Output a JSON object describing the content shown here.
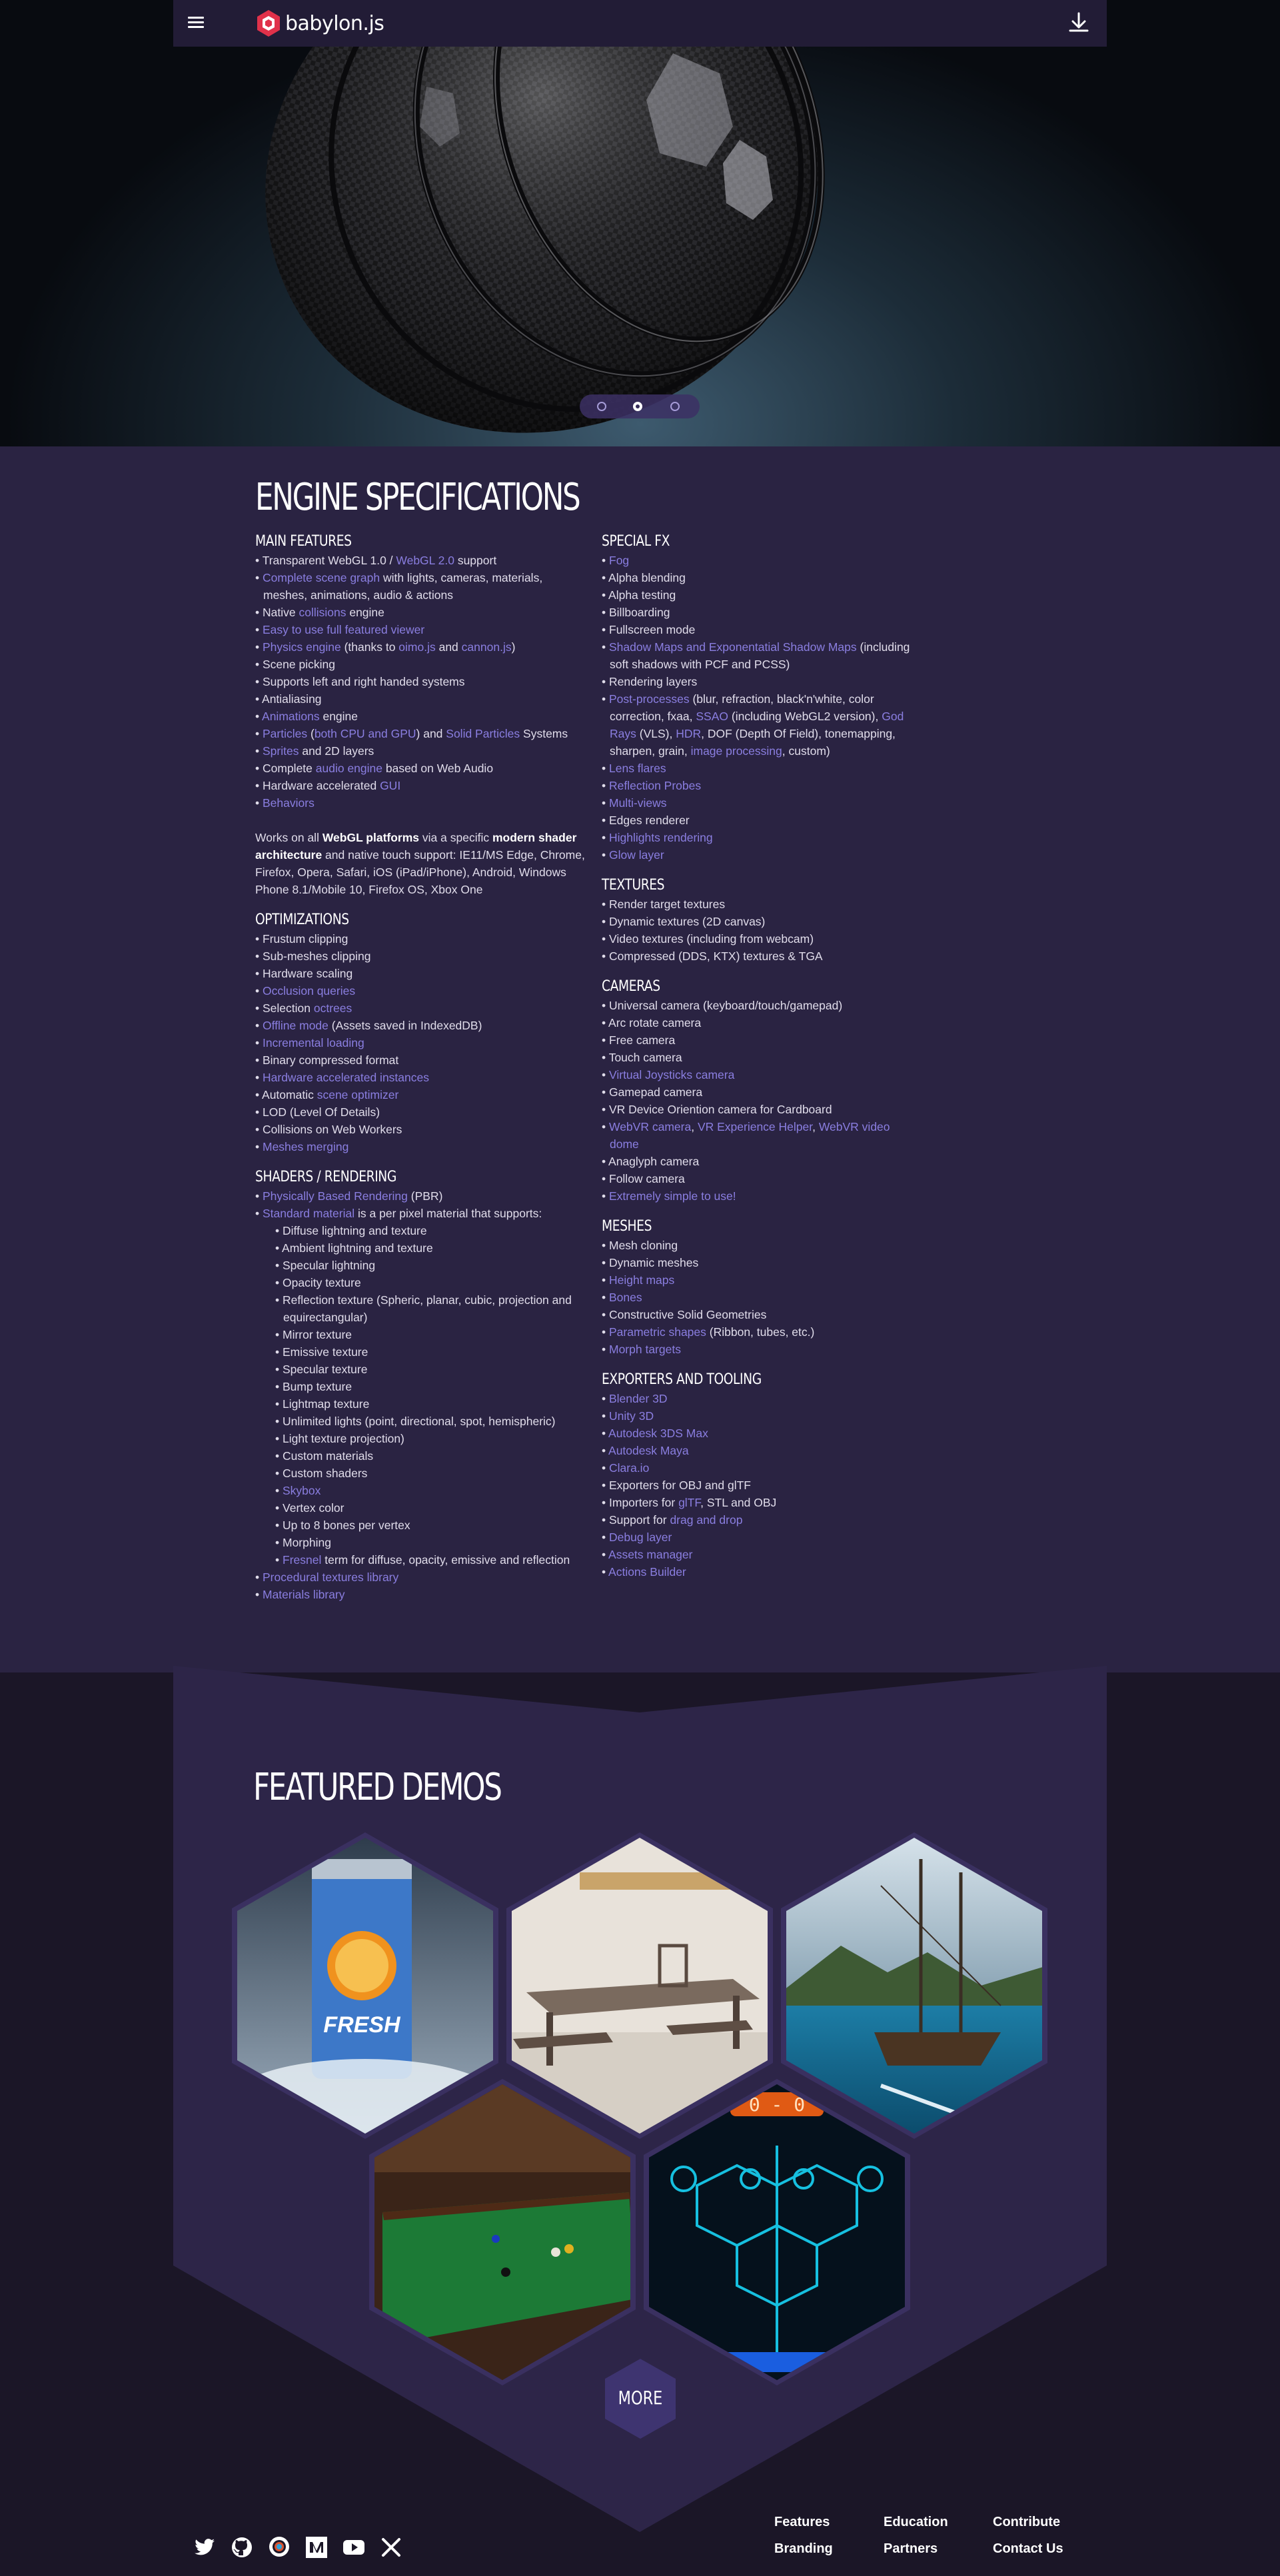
{
  "header": {
    "logo_text": "babylon.js",
    "menu_icon": "hamburger-menu-icon",
    "download_icon": "download-icon"
  },
  "hero": {
    "carousel_dots": 3,
    "active_dot": 2
  },
  "specs": {
    "title": "ENGINE SPECIFICATIONS",
    "main_features": {
      "heading": "MAIN FEATURES",
      "items": [
        [
          {
            "t": "Transparent WebGL 1.0 / "
          },
          {
            "t": "WebGL 2.0",
            "l": true
          },
          {
            "t": " support"
          }
        ],
        [
          {
            "t": "Complete scene graph",
            "l": true
          },
          {
            "t": " with lights, cameras, materials, meshes, animations, audio & actions"
          }
        ],
        [
          {
            "t": "Native "
          },
          {
            "t": "collisions",
            "l": true
          },
          {
            "t": " engine"
          }
        ],
        [
          {
            "t": "Easy to use full featured viewer",
            "l": true
          }
        ],
        [
          {
            "t": "Physics engine",
            "l": true
          },
          {
            "t": " (thanks to "
          },
          {
            "t": "oimo.js",
            "l": true
          },
          {
            "t": " and "
          },
          {
            "t": "cannon.js",
            "l": true
          },
          {
            "t": ")"
          }
        ],
        [
          {
            "t": "Scene picking"
          }
        ],
        [
          {
            "t": "Supports left and right handed systems"
          }
        ],
        [
          {
            "t": "Antialiasing"
          }
        ],
        [
          {
            "t": "Animations",
            "l": true
          },
          {
            "t": " engine"
          }
        ],
        [
          {
            "t": "Particles",
            "l": true
          },
          {
            "t": " ("
          },
          {
            "t": "both CPU and GPU",
            "l": true
          },
          {
            "t": ") and "
          },
          {
            "t": "Solid Particles",
            "l": true
          },
          {
            "t": " Systems"
          }
        ],
        [
          {
            "t": "Sprites",
            "l": true
          },
          {
            "t": " and 2D layers"
          }
        ],
        [
          {
            "t": "Complete "
          },
          {
            "t": "audio engine",
            "l": true
          },
          {
            "t": " based on Web Audio"
          }
        ],
        [
          {
            "t": "Hardware accelerated "
          },
          {
            "t": "GUI",
            "l": true
          }
        ],
        [
          {
            "t": "Behaviors",
            "l": true
          }
        ]
      ],
      "platform_text_1": "Works on all ",
      "platform_bold_1": "WebGL platforms",
      "platform_text_2": " via a specific ",
      "platform_bold_2": "modern shader architecture",
      "platform_text_3": " and native touch support: IE11/MS Edge, Chrome, Firefox, Opera, Safari, iOS (iPad/iPhone), Android, Windows Phone 8.1/Mobile 10, Firefox OS, Xbox One"
    },
    "optimizations": {
      "heading": "OPTIMIZATIONS",
      "items": [
        [
          {
            "t": "Frustum clipping"
          }
        ],
        [
          {
            "t": "Sub-meshes clipping"
          }
        ],
        [
          {
            "t": "Hardware scaling"
          }
        ],
        [
          {
            "t": "Occlusion queries",
            "l": true
          }
        ],
        [
          {
            "t": "Selection "
          },
          {
            "t": "octrees",
            "l": true
          }
        ],
        [
          {
            "t": "Offline mode",
            "l": true
          },
          {
            "t": " (Assets saved in IndexedDB)"
          }
        ],
        [
          {
            "t": "Incremental loading",
            "l": true
          }
        ],
        [
          {
            "t": "Binary compressed format"
          }
        ],
        [
          {
            "t": "Hardware accelerated instances",
            "l": true
          }
        ],
        [
          {
            "t": "Automatic "
          },
          {
            "t": "scene optimizer",
            "l": true
          }
        ],
        [
          {
            "t": "LOD (Level Of Details)"
          }
        ],
        [
          {
            "t": "Collisions on Web Workers"
          }
        ],
        [
          {
            "t": "Meshes merging",
            "l": true
          }
        ]
      ]
    },
    "shaders": {
      "heading": "SHADERS / RENDERING",
      "items": [
        [
          {
            "t": "Physically Based Rendering",
            "l": true
          },
          {
            "t": " (PBR)"
          }
        ],
        [
          {
            "t": "Standard material",
            "l": true
          },
          {
            "t": " is a per pixel material that supports:"
          }
        ]
      ],
      "sub_items": [
        [
          {
            "t": "Diffuse lightning and texture"
          }
        ],
        [
          {
            "t": "Ambient lightning and texture"
          }
        ],
        [
          {
            "t": "Specular lightning"
          }
        ],
        [
          {
            "t": "Opacity texture"
          }
        ],
        [
          {
            "t": "Reflection texture (Spheric, planar, cubic, projection and equirectangular)"
          }
        ],
        [
          {
            "t": "Mirror texture"
          }
        ],
        [
          {
            "t": "Emissive texture"
          }
        ],
        [
          {
            "t": "Specular texture"
          }
        ],
        [
          {
            "t": "Bump texture"
          }
        ],
        [
          {
            "t": "Lightmap texture"
          }
        ],
        [
          {
            "t": "Unlimited lights (point, directional, spot, hemispheric)"
          }
        ],
        [
          {
            "t": "Light texture projection)"
          }
        ],
        [
          {
            "t": "Custom materials"
          }
        ],
        [
          {
            "t": "Custom shaders"
          }
        ],
        [
          {
            "t": "Skybox",
            "l": true
          }
        ],
        [
          {
            "t": "Vertex color"
          }
        ],
        [
          {
            "t": "Up to 8 bones per vertex"
          }
        ],
        [
          {
            "t": "Morphing"
          }
        ],
        [
          {
            "t": "Fresnel",
            "l": true
          },
          {
            "t": " term for diffuse, opacity, emissive and reflection"
          }
        ]
      ],
      "tail_items": [
        [
          {
            "t": "Procedural textures library",
            "l": true
          }
        ],
        [
          {
            "t": "Materials library",
            "l": true
          }
        ]
      ]
    },
    "special_fx": {
      "heading": "SPECIAL FX",
      "items": [
        [
          {
            "t": "Fog",
            "l": true
          }
        ],
        [
          {
            "t": "Alpha blending"
          }
        ],
        [
          {
            "t": "Alpha testing"
          }
        ],
        [
          {
            "t": "Billboarding"
          }
        ],
        [
          {
            "t": "Fullscreen mode"
          }
        ],
        [
          {
            "t": "Shadow Maps and Exponentatial Shadow Maps",
            "l": true
          },
          {
            "t": " (including soft shadows with PCF and PCSS)"
          }
        ],
        [
          {
            "t": "Rendering layers"
          }
        ],
        [
          {
            "t": "Post-processes",
            "l": true
          },
          {
            "t": " (blur, refraction, black'n'white, color correction, fxaa, "
          },
          {
            "t": "SSAO",
            "l": true
          },
          {
            "t": " (including WebGL2 version), "
          },
          {
            "t": "God Rays",
            "l": true
          },
          {
            "t": " (VLS), "
          },
          {
            "t": "HDR",
            "l": true
          },
          {
            "t": ", DOF (Depth Of Field), tonemapping, sharpen, grain, "
          },
          {
            "t": "image processing",
            "l": true
          },
          {
            "t": ", custom)"
          }
        ],
        [
          {
            "t": "Lens flares",
            "l": true
          }
        ],
        [
          {
            "t": "Reflection Probes",
            "l": true
          }
        ],
        [
          {
            "t": "Multi-views",
            "l": true
          }
        ],
        [
          {
            "t": "Edges renderer"
          }
        ],
        [
          {
            "t": "Highlights rendering",
            "l": true
          }
        ],
        [
          {
            "t": "Glow layer",
            "l": true
          }
        ]
      ]
    },
    "textures": {
      "heading": "TEXTURES",
      "items": [
        [
          {
            "t": "Render target textures"
          }
        ],
        [
          {
            "t": "Dynamic textures (2D canvas)"
          }
        ],
        [
          {
            "t": "Video textures (including from webcam)"
          }
        ],
        [
          {
            "t": "Compressed (DDS, KTX) textures & TGA"
          }
        ]
      ]
    },
    "cameras": {
      "heading": "CAMERAS",
      "items": [
        [
          {
            "t": "Universal camera (keyboard/touch/gamepad)"
          }
        ],
        [
          {
            "t": "Arc rotate camera"
          }
        ],
        [
          {
            "t": "Free camera"
          }
        ],
        [
          {
            "t": "Touch camera"
          }
        ],
        [
          {
            "t": "Virtual Joysticks camera",
            "l": true
          }
        ],
        [
          {
            "t": "Gamepad camera"
          }
        ],
        [
          {
            "t": "VR Device Oriention camera for Cardboard"
          }
        ],
        [
          {
            "t": "WebVR camera",
            "l": true
          },
          {
            "t": ", "
          },
          {
            "t": "VR Experience Helper",
            "l": true
          },
          {
            "t": ", "
          },
          {
            "t": "WebVR video dome",
            "l": true
          }
        ],
        [
          {
            "t": "Anaglyph camera"
          }
        ],
        [
          {
            "t": "Follow camera"
          }
        ],
        [
          {
            "t": "Extremely simple to use!",
            "l": true
          }
        ]
      ]
    },
    "meshes": {
      "heading": "MESHES",
      "items": [
        [
          {
            "t": "Mesh cloning"
          }
        ],
        [
          {
            "t": "Dynamic meshes"
          }
        ],
        [
          {
            "t": "Height maps",
            "l": true
          }
        ],
        [
          {
            "t": "Bones",
            "l": true
          }
        ],
        [
          {
            "t": "Constructive Solid Geometries"
          }
        ],
        [
          {
            "t": "Parametric shapes",
            "l": true
          },
          {
            "t": " (Ribbon, tubes, etc.)"
          }
        ],
        [
          {
            "t": "Morph targets",
            "l": true
          }
        ]
      ]
    },
    "exporters": {
      "heading": "EXPORTERS AND TOOLING",
      "items": [
        [
          {
            "t": "Blender 3D",
            "l": true
          }
        ],
        [
          {
            "t": "Unity 3D",
            "l": true
          }
        ],
        [
          {
            "t": "Autodesk 3DS Max",
            "l": true
          }
        ],
        [
          {
            "t": "Autodesk Maya",
            "l": true
          }
        ],
        [
          {
            "t": "Clara.io",
            "l": true
          }
        ],
        [
          {
            "t": "Exporters for OBJ and glTF"
          }
        ],
        [
          {
            "t": "Importers for "
          },
          {
            "t": "glTF",
            "l": true
          },
          {
            "t": ", STL and OBJ"
          }
        ],
        [
          {
            "t": "Support for "
          },
          {
            "t": "drag and drop",
            "l": true
          }
        ],
        [
          {
            "t": "Debug layer",
            "l": true
          }
        ],
        [
          {
            "t": "Assets manager",
            "l": true
          }
        ],
        [
          {
            "t": "Actions Builder",
            "l": true
          }
        ]
      ]
    }
  },
  "demos": {
    "title": "FEATURED DEMOS",
    "more_label": "MORE",
    "items": [
      {
        "name": "fresh-juice-can-demo"
      },
      {
        "name": "dining-table-demo"
      },
      {
        "name": "pirate-ship-demo"
      },
      {
        "name": "billiards-demo"
      },
      {
        "name": "neon-game-board-demo"
      }
    ]
  },
  "footer": {
    "social": [
      "twitter-icon",
      "github-icon",
      "forum-icon",
      "medium-icon",
      "youtube-icon",
      "x-icon"
    ],
    "links": {
      "features": "Features",
      "education": "Education",
      "contribute": "Contribute",
      "branding": "Branding",
      "partners": "Partners",
      "contact": "Contact Us"
    }
  },
  "colors": {
    "link": "#8a7ee0",
    "page_bg": "#2a2342",
    "nav_bg": "#221c36",
    "footer_bg": "#1b1627",
    "logo_red": "#e0314a"
  }
}
